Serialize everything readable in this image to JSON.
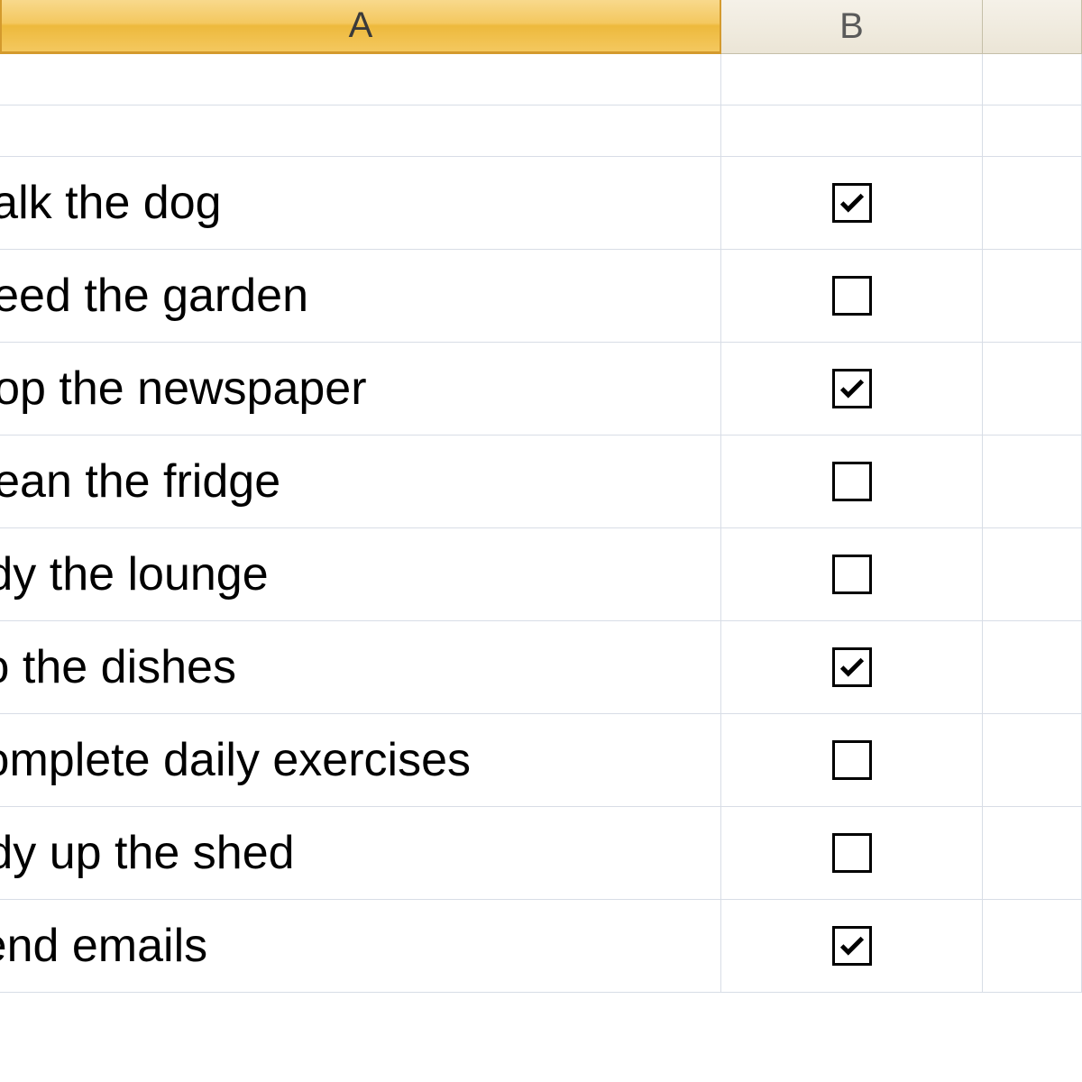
{
  "columns": {
    "a": "A",
    "b": "B",
    "c": ""
  },
  "rows": [
    {
      "text": "",
      "checkbox": null
    },
    {
      "text": "",
      "checkbox": null
    },
    {
      "text": "Walk the dog",
      "checkbox": true
    },
    {
      "text": "Weed the garden",
      "checkbox": false
    },
    {
      "text": "Stop the newspaper",
      "checkbox": true
    },
    {
      "text": "Clean the fridge",
      "checkbox": false
    },
    {
      "text": "Tidy the lounge",
      "checkbox": false
    },
    {
      "text": "Do the dishes",
      "checkbox": true
    },
    {
      "text": "Complete daily exercises",
      "checkbox": false
    },
    {
      "text": "Tidy up the shed",
      "checkbox": false
    },
    {
      "text": "Send emails",
      "checkbox": true
    }
  ]
}
